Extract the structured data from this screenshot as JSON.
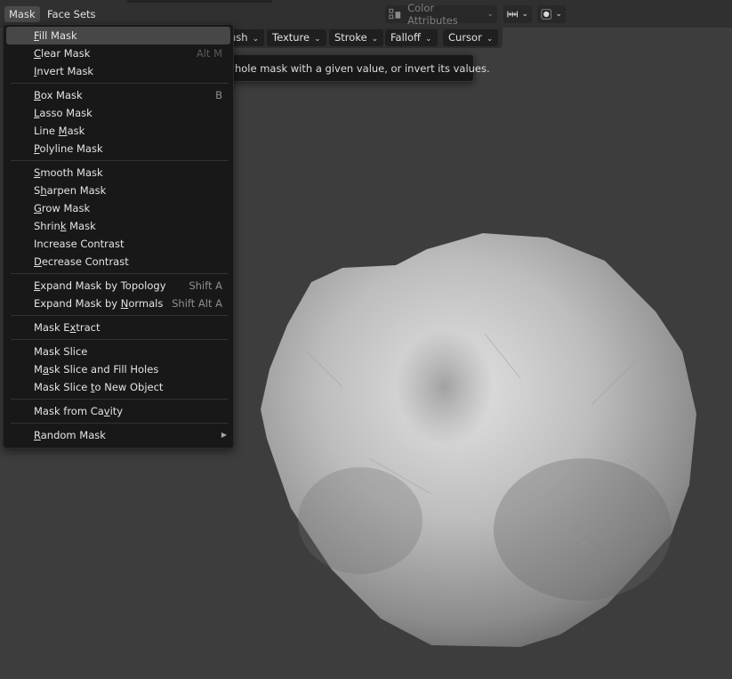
{
  "header": {
    "menus": [
      {
        "label": "Mask",
        "active": true
      },
      {
        "label": "Face Sets",
        "active": false
      }
    ],
    "color_attributes_label": "Color Attributes"
  },
  "toolbar": {
    "items": [
      "ush",
      "Texture",
      "Stroke",
      "Falloff",
      "Cursor"
    ]
  },
  "mask_menu": {
    "items": [
      {
        "label": "Fill Mask",
        "underline": "F",
        "shortcut": "",
        "highlighted": true
      },
      {
        "label": "Clear Mask",
        "underline": "C",
        "shortcut": "Alt M"
      },
      {
        "label": "Invert Mask",
        "underline": "I",
        "shortcut": ""
      },
      {
        "label": "Box Mask",
        "underline": "B",
        "shortcut": "B"
      },
      {
        "label": "Lasso Mask",
        "underline": "L",
        "shortcut": ""
      },
      {
        "label": "Line Mask",
        "underline": "M",
        "shortcut": ""
      },
      {
        "label": "Polyline Mask",
        "underline": "P",
        "shortcut": ""
      },
      {
        "label": "Smooth Mask",
        "underline": "S",
        "shortcut": ""
      },
      {
        "label": "Sharpen Mask",
        "underline": "h",
        "shortcut": ""
      },
      {
        "label": "Grow Mask",
        "underline": "G",
        "shortcut": ""
      },
      {
        "label": "Shrink Mask",
        "underline": "k",
        "shortcut": ""
      },
      {
        "label": "Increase Contrast",
        "underline": "",
        "shortcut": ""
      },
      {
        "label": "Decrease Contrast",
        "underline": "D",
        "shortcut": ""
      },
      {
        "label": "Expand Mask by Topology",
        "underline": "E",
        "shortcut": "Shift A"
      },
      {
        "label": "Expand Mask by Normals",
        "underline": "N",
        "shortcut": "Shift Alt A"
      },
      {
        "label": "Mask Extract",
        "underline": "x",
        "shortcut": ""
      },
      {
        "label": "Mask Slice",
        "underline": "",
        "shortcut": ""
      },
      {
        "label": "Mask Slice and Fill Holes",
        "underline": "a",
        "shortcut": ""
      },
      {
        "label": "Mask Slice to New Object",
        "underline": "t",
        "shortcut": ""
      },
      {
        "label": "Mask from Cavity",
        "underline": "v",
        "shortcut": ""
      },
      {
        "label": "Random Mask",
        "underline": "R",
        "shortcut": "",
        "submenu": true
      }
    ]
  },
  "tooltip": {
    "text": "Fill the whole mask with a given value, or invert its values."
  }
}
